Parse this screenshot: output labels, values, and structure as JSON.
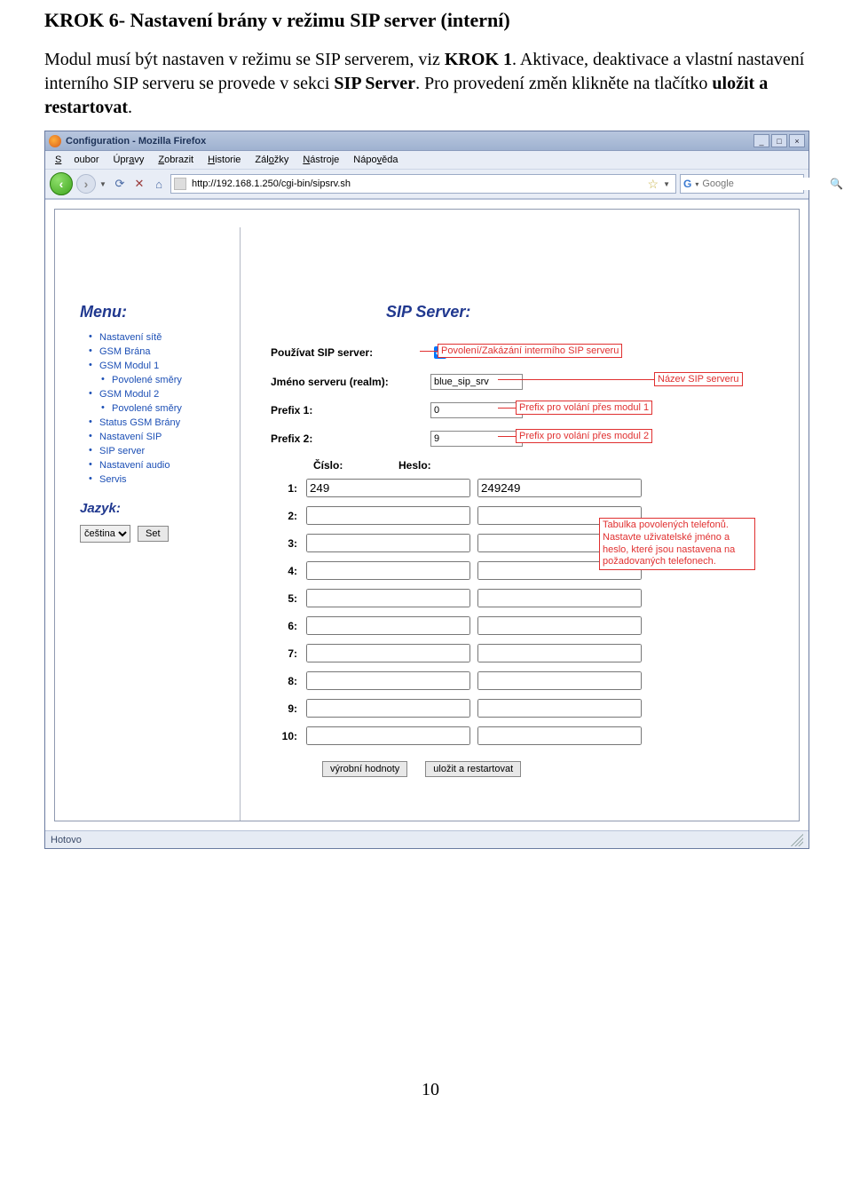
{
  "doc": {
    "heading": "KROK 6- Nastavení brány v režimu SIP server (interní)",
    "p1a": "Modul musí být nastaven v režimu se SIP serverem, viz ",
    "p1b": "KROK 1",
    "p1c": ". Aktivace, deaktivace a vlastní nastavení interního SIP serveru se provede v sekci ",
    "p1d": "SIP Server",
    "p1e": ". Pro provedení změn klikněte na tlačítko ",
    "p1f": "uložit a restartovat",
    "p1g": ".",
    "pagenum": "10"
  },
  "window": {
    "title": "Configuration - Mozilla Firefox",
    "status": "Hotovo"
  },
  "menubar": [
    "Soubor",
    "Úpravy",
    "Zobrazit",
    "Historie",
    "Záložky",
    "Nástroje",
    "Nápověda"
  ],
  "url": "http://192.168.1.250/cgi-bin/sipsrv.sh",
  "search_placeholder": "Google",
  "sidebar": {
    "title": "Menu:",
    "items": [
      {
        "label": "Nastavení sítě",
        "indent": false
      },
      {
        "label": "GSM Brána",
        "indent": false
      },
      {
        "label": "GSM Modul 1",
        "indent": false
      },
      {
        "label": "Povolené směry",
        "indent": true
      },
      {
        "label": "GSM Modul 2",
        "indent": false
      },
      {
        "label": "Povolené směry",
        "indent": true
      },
      {
        "label": "Status GSM Brány",
        "indent": false
      },
      {
        "label": "Nastavení SIP",
        "indent": false
      },
      {
        "label": "SIP server",
        "indent": false
      },
      {
        "label": "Nastavení audio",
        "indent": false
      },
      {
        "label": "Servis",
        "indent": false
      }
    ],
    "lang_label": "Jazyk:",
    "lang_value": "čeština",
    "set_btn": "Set"
  },
  "main": {
    "title": "SIP Server:",
    "labels": {
      "use_server": "Používat SIP server:",
      "realm": "Jméno serveru (realm):",
      "prefix1": "Prefix 1:",
      "prefix2": "Prefix 2:",
      "col_num": "Číslo:",
      "col_pass": "Heslo:"
    },
    "values": {
      "realm": "blue_sip_srv",
      "prefix1": "0",
      "prefix2": "9",
      "checked": true
    },
    "rows": [
      {
        "n": "1:",
        "num": "249",
        "pass": "249249"
      },
      {
        "n": "2:",
        "num": "",
        "pass": ""
      },
      {
        "n": "3:",
        "num": "",
        "pass": ""
      },
      {
        "n": "4:",
        "num": "",
        "pass": ""
      },
      {
        "n": "5:",
        "num": "",
        "pass": ""
      },
      {
        "n": "6:",
        "num": "",
        "pass": ""
      },
      {
        "n": "7:",
        "num": "",
        "pass": ""
      },
      {
        "n": "8:",
        "num": "",
        "pass": ""
      },
      {
        "n": "9:",
        "num": "",
        "pass": ""
      },
      {
        "n": "10:",
        "num": "",
        "pass": ""
      }
    ],
    "buttons": {
      "defaults": "výrobní hodnoty",
      "save": "uložit a restartovat"
    }
  },
  "callouts": {
    "c1": "Povolení/Zakázání intermího SIP serveru",
    "c2": "Název SIP serveru",
    "c3": "Prefix pro volání přes modul 1",
    "c4": "Prefix pro volání přes modul 2",
    "c5": "Tabulka povolených telefonů. Nastavte uživatelské jméno a heslo, které jsou nastavena na požadovaných telefonech."
  }
}
